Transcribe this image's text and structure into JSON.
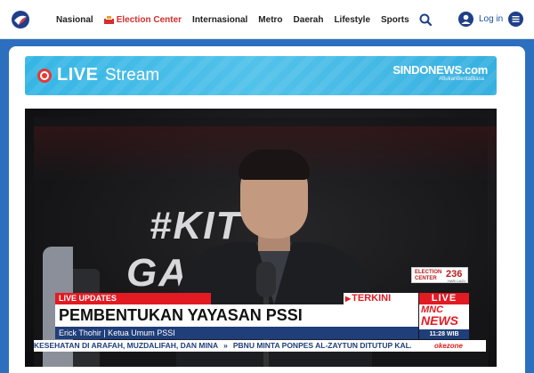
{
  "header": {
    "nav": [
      {
        "label": "Nasional"
      },
      {
        "label": "Election Center"
      },
      {
        "label": "Internasional"
      },
      {
        "label": "Metro"
      },
      {
        "label": "Daerah"
      },
      {
        "label": "Lifestyle"
      },
      {
        "label": "Sports"
      }
    ],
    "login_label": "Log in",
    "icons": [
      "logo-icon",
      "ballot-icon",
      "search-icon",
      "user-icon",
      "menu-icon"
    ]
  },
  "banner": {
    "live": "LIVE",
    "stream": "Stream",
    "brand": "SINDONEWS.com",
    "brand_tagline": "#BukanBeritaBiasa"
  },
  "video": {
    "backdrop_line1": "#KIT",
    "backdrop_line2": "GA",
    "election_badge": {
      "text1": "ELECTION",
      "text2": "CENTER",
      "number": "236",
      "days": "HARI LAGI"
    },
    "live_updates": "LIVE UPDATES",
    "terkini": "TERKINI",
    "live_tag": "LIVE",
    "headline": "PEMBENTUKAN YAYASAN PSSI",
    "speaker": "Erick Thohir | Ketua Umum PSSI",
    "network": {
      "line1": "MNC",
      "line2": "NEWS"
    },
    "clock": "11:28 WIB",
    "ticker": [
      "KESEHATAN DI ARAFAH, MUZDALIFAH, DAN MINA",
      "PBNU MINTA PONPES AL-ZAYTUN DITUTUP KALA"
    ],
    "ticker_brand": "okezone"
  },
  "colors": {
    "page_bg": "#2d6fbf",
    "accent_red": "#e21b23",
    "navy": "#1f3e7a",
    "banner_blue": "#36b6e5",
    "election_red": "#d32f2f"
  }
}
